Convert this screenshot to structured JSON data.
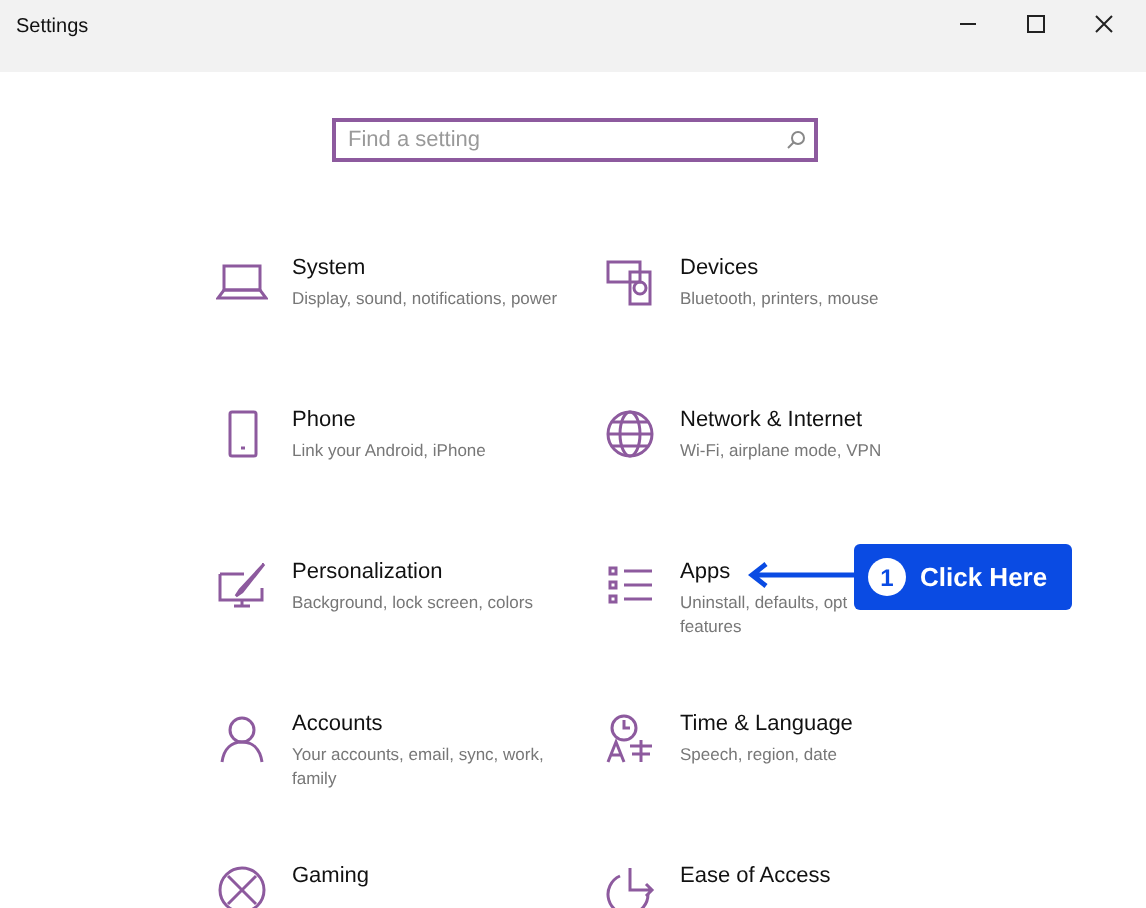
{
  "window": {
    "title": "Settings"
  },
  "search": {
    "placeholder": "Find a setting"
  },
  "categories": [
    {
      "title": "System",
      "description": "Display, sound, notifications, power"
    },
    {
      "title": "Devices",
      "description": "Bluetooth, printers, mouse"
    },
    {
      "title": "Phone",
      "description": "Link your Android, iPhone"
    },
    {
      "title": "Network & Internet",
      "description": "Wi-Fi, airplane mode, VPN"
    },
    {
      "title": "Personalization",
      "description": "Background, lock screen, colors"
    },
    {
      "title": "Apps",
      "description": "Uninstall, defaults, opt",
      "description_2": "features"
    },
    {
      "title": "Accounts",
      "description": "Your accounts, email, sync, work, family"
    },
    {
      "title": "Time & Language",
      "description": "Speech, region, date"
    },
    {
      "title": "Gaming"
    },
    {
      "title": "Ease of Access"
    }
  ],
  "callout": {
    "number": "1",
    "label": "Click Here"
  }
}
